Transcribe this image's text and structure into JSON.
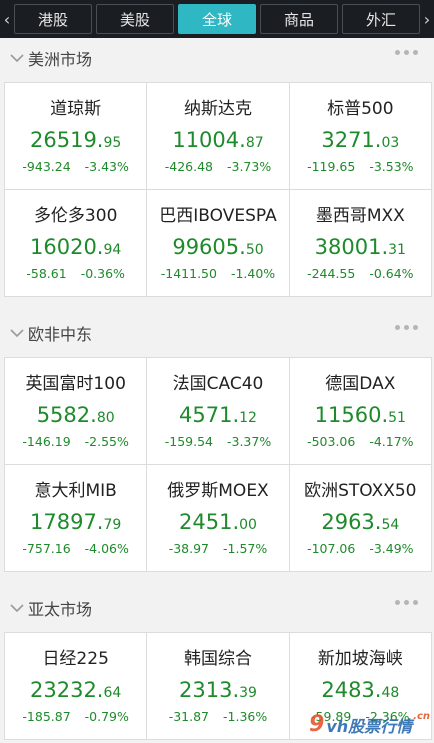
{
  "tabs": [
    {
      "label": "港股",
      "active": false
    },
    {
      "label": "美股",
      "active": false
    },
    {
      "label": "全球",
      "active": true
    },
    {
      "label": "商品",
      "active": false
    },
    {
      "label": "外汇",
      "active": false
    }
  ],
  "sections": [
    {
      "title": "美洲市场",
      "cards": [
        {
          "name": "道琼斯",
          "price_int": "26519.",
          "price_dec": "95",
          "change": "-943.24",
          "pct": "-3.43%"
        },
        {
          "name": "纳斯达克",
          "price_int": "11004.",
          "price_dec": "87",
          "change": "-426.48",
          "pct": "-3.73%"
        },
        {
          "name": "标普500",
          "price_int": "3271.",
          "price_dec": "03",
          "change": "-119.65",
          "pct": "-3.53%"
        },
        {
          "name": "多伦多300",
          "price_int": "16020.",
          "price_dec": "94",
          "change": "-58.61",
          "pct": "-0.36%"
        },
        {
          "name": "巴西IBOVESPA",
          "price_int": "99605.",
          "price_dec": "50",
          "change": "-1411.50",
          "pct": "-1.40%"
        },
        {
          "name": "墨西哥MXX",
          "price_int": "38001.",
          "price_dec": "31",
          "change": "-244.55",
          "pct": "-0.64%"
        }
      ]
    },
    {
      "title": "欧非中东",
      "cards": [
        {
          "name": "英国富时100",
          "price_int": "5582.",
          "price_dec": "80",
          "change": "-146.19",
          "pct": "-2.55%"
        },
        {
          "name": "法国CAC40",
          "price_int": "4571.",
          "price_dec": "12",
          "change": "-159.54",
          "pct": "-3.37%"
        },
        {
          "name": "德国DAX",
          "price_int": "11560.",
          "price_dec": "51",
          "change": "-503.06",
          "pct": "-4.17%"
        },
        {
          "name": "意大利MIB",
          "price_int": "17897.",
          "price_dec": "79",
          "change": "-757.16",
          "pct": "-4.06%"
        },
        {
          "name": "俄罗斯MOEX",
          "price_int": "2451.",
          "price_dec": "00",
          "change": "-38.97",
          "pct": "-1.57%"
        },
        {
          "name": "欧洲STOXX50",
          "price_int": "2963.",
          "price_dec": "54",
          "change": "-107.06",
          "pct": "-3.49%"
        }
      ]
    },
    {
      "title": "亚太市场",
      "cards": [
        {
          "name": "日经225",
          "price_int": "23232.",
          "price_dec": "64",
          "change": "-185.87",
          "pct": "-0.79%"
        },
        {
          "name": "韩国综合",
          "price_int": "2313.",
          "price_dec": "39",
          "change": "-31.87",
          "pct": "-1.36%"
        },
        {
          "name": "新加坡海峡",
          "price_int": "2483.",
          "price_dec": "48",
          "change": "-59.89",
          "pct": "-2.36%"
        }
      ]
    }
  ],
  "watermark": {
    "logo": "9",
    "text": "vh股票行情",
    "suffix": ".cn"
  },
  "colors": {
    "accent": "#2fb7c3",
    "down": "#1f8a2b",
    "topbar": "#1a1d21"
  }
}
